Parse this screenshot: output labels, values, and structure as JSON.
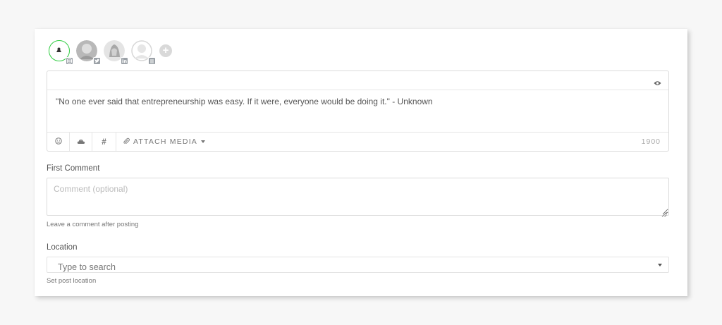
{
  "accounts": [
    {
      "name": "account-instagram",
      "network": "instagram",
      "selected": true
    },
    {
      "name": "account-twitter",
      "network": "twitter",
      "selected": false
    },
    {
      "name": "account-linkedin",
      "network": "linkedin",
      "selected": false
    },
    {
      "name": "account-other",
      "network": "other",
      "selected": false
    }
  ],
  "editor": {
    "post_text": "\"No one ever said that entrepreneurship was easy. If it were, everyone would be doing it.\" - Unknown",
    "preview_icon": "eye-icon",
    "toolbar": {
      "emoji_icon": "smiley-icon",
      "weather_icon": "cloud-icon",
      "hashtag_label": "#",
      "attach_label": "ATTACH MEDIA",
      "char_count": "1900"
    }
  },
  "first_comment": {
    "label": "First Comment",
    "placeholder": "Comment (optional)",
    "help": "Leave a comment after posting"
  },
  "location": {
    "label": "Location",
    "value": "Type to search",
    "help": "Set post location"
  },
  "colors": {
    "selected_ring": "#2ecc40",
    "badge": "#9aa0a6"
  }
}
